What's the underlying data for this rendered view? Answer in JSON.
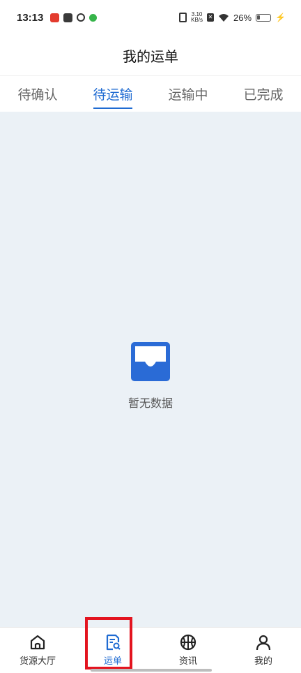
{
  "status_bar": {
    "time": "13:13",
    "net_speed_top": "3.10",
    "net_speed_bottom": "KB/s",
    "battery_text": "26%",
    "battery_level": 0.26
  },
  "header": {
    "title": "我的运单"
  },
  "tabs": [
    {
      "label": "待确认",
      "active": false
    },
    {
      "label": "待运输",
      "active": true
    },
    {
      "label": "运输中",
      "active": false
    },
    {
      "label": "已完成",
      "active": false
    }
  ],
  "empty_state": {
    "text": "暂无数据",
    "icon": "inbox-icon"
  },
  "bottom_nav": [
    {
      "label": "货源大厅",
      "icon": "home-icon",
      "active": false
    },
    {
      "label": "运单",
      "icon": "waybill-search-icon",
      "active": true
    },
    {
      "label": "资讯",
      "icon": "basketball-icon",
      "active": false
    },
    {
      "label": "我的",
      "icon": "user-icon",
      "active": false
    }
  ],
  "colors": {
    "accent": "#1f6bd2",
    "background": "#ebf1f6",
    "highlight": "#e3141f"
  }
}
